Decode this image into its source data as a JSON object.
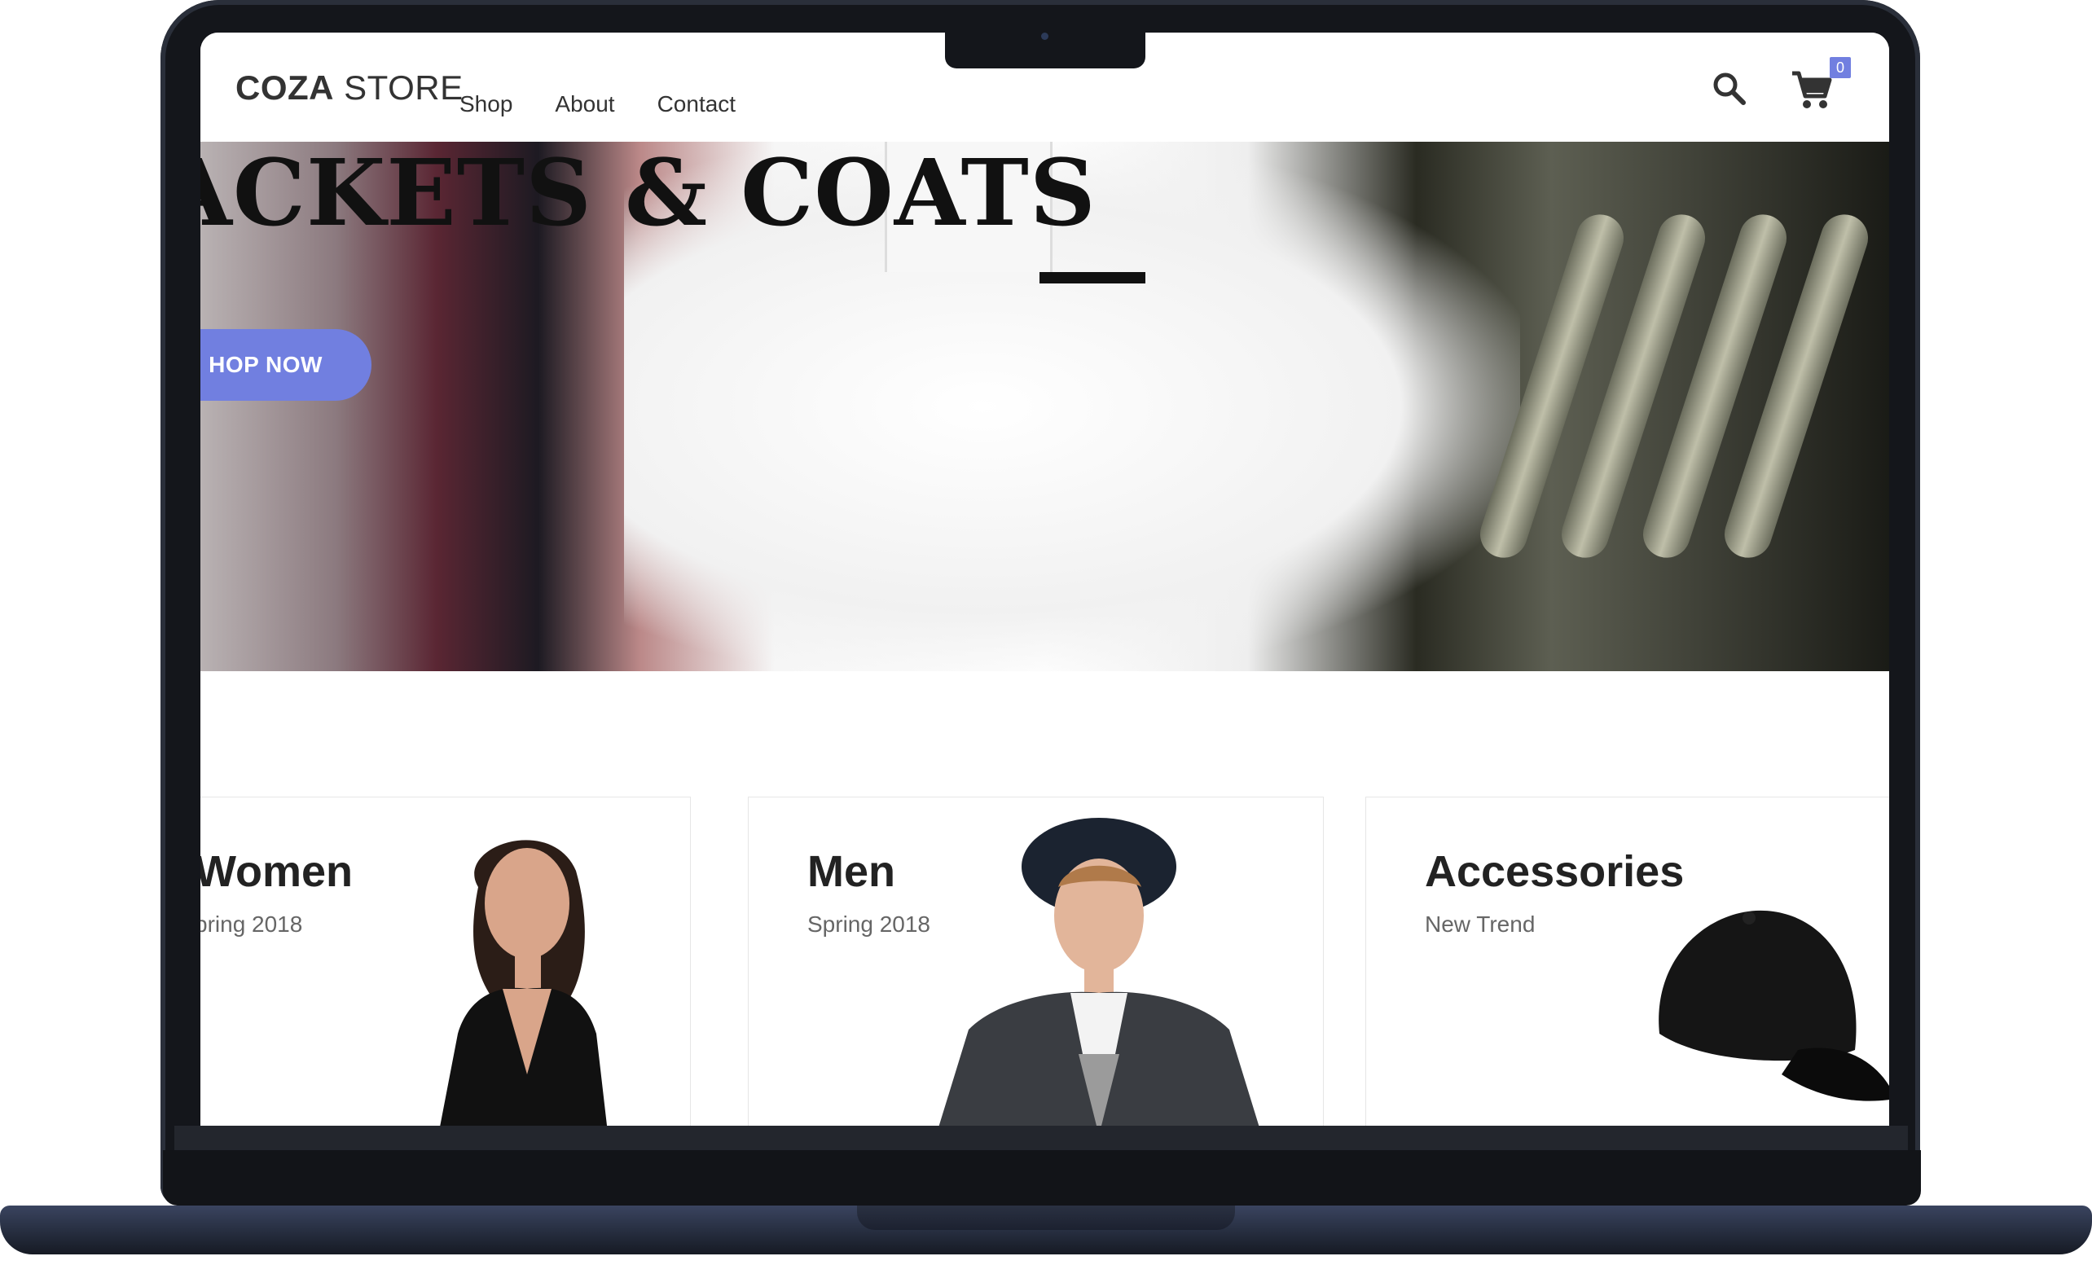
{
  "header": {
    "logo_bold": "COZA",
    "logo_light": " STORE",
    "nav": [
      "Shop",
      "About",
      "Contact"
    ],
    "cart_count": "0",
    "icons": [
      "search-icon",
      "cart-icon"
    ]
  },
  "hero": {
    "title": "ACKETS & COATS",
    "cta": "HOP NOW"
  },
  "banners": [
    {
      "title": "Women",
      "subtitle": "pring 2018"
    },
    {
      "title": "Men",
      "subtitle": "Spring 2018"
    },
    {
      "title": "Accessories",
      "subtitle": "New Trend"
    }
  ],
  "colors": {
    "accent": "#717fe0",
    "text_dark": "#222222",
    "text_muted": "#666666",
    "frame": "#14161b"
  }
}
